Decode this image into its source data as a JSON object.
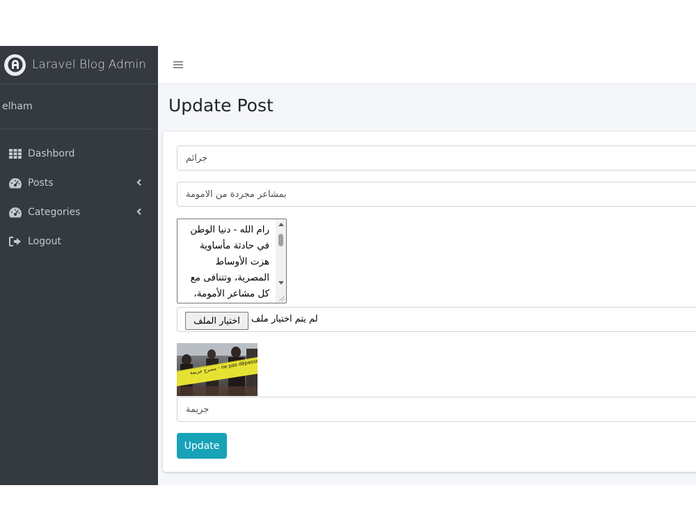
{
  "brand": {
    "name": "Laravel Blog Admin"
  },
  "user": {
    "name": "elham"
  },
  "sidebar": {
    "items": [
      {
        "label": "Dashbord",
        "icon": "grid-icon"
      },
      {
        "label": "Posts",
        "icon": "tachometer-icon",
        "has_submenu": true
      },
      {
        "label": "Categories",
        "icon": "tachometer-icon",
        "has_submenu": true
      },
      {
        "label": "Logout",
        "icon": "sign-out-icon"
      }
    ]
  },
  "topbar": {
    "menu_icon": "hamburger-icon"
  },
  "page": {
    "title": "Update Post"
  },
  "form": {
    "title_value": "جرائم",
    "subtitle_value": "بمشاعر مجردة من الامومة",
    "body_text": "رام الله - دنيا الوطن\nفي حادثة مأساوية\nهزت الأوساط\nالمصرية، وتتنافى مع\nكل مشاعر الأمومة،",
    "file_button_label": "اختيار الملف",
    "file_status": "لم يتم اختيار ملف",
    "image_tape_text": "مسرح جريمة - ne pas dépasser",
    "category_value": "جريمة",
    "submit_label": "Update"
  },
  "colors": {
    "sidebar_bg": "#343a40",
    "content_bg": "#f4f6f9",
    "accent": "#17a2b8"
  }
}
